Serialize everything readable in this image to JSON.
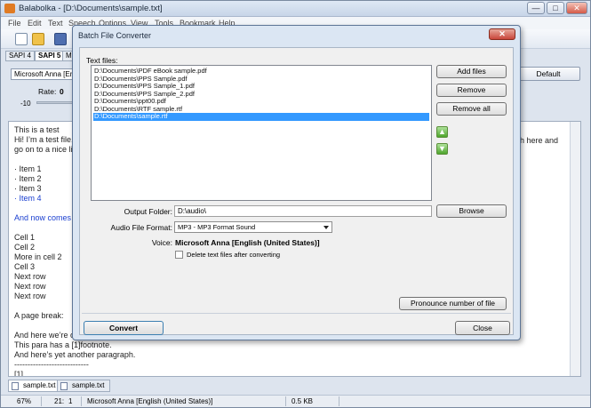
{
  "window": {
    "title": "Balabolka - [D:\\Documents\\sample.txt]",
    "controls": {
      "minimize": "—",
      "maximize": "□",
      "close": "✕"
    }
  },
  "menu": [
    "File",
    "Edit",
    "Text",
    "Speech",
    "Options",
    "View",
    "Tools",
    "Bookmark",
    "Help"
  ],
  "toolbar": {
    "icons": [
      "new-document-icon",
      "open-folder-icon",
      "save-icon"
    ]
  },
  "api_tabs": [
    "SAPI 4",
    "SAPI 5",
    "Mic"
  ],
  "voice_panel": {
    "voice_select": "Microsoft Anna [English",
    "default_button": "Default",
    "rate_label": "Rate:",
    "rate_value": "0",
    "rate_min": "-10"
  },
  "editor": {
    "lines": [
      {
        "text": "This is a test",
        "style": "normal"
      },
      {
        "text": "Hi! I’m a test file. T",
        "style": "normal"
      },
      {
        "text": "go on to a nice littl",
        "style": "normal"
      },
      {
        "text": "",
        "style": "normal"
      },
      {
        "text": "·  Item 1",
        "style": "normal"
      },
      {
        "text": "·  Item 2",
        "style": "normal"
      },
      {
        "text": "·  Item 3",
        "style": "normal"
      },
      {
        "text": "·  Item 4",
        "style": "blue"
      },
      {
        "text": "",
        "style": "normal"
      },
      {
        "text": "And now comes a",
        "style": "blue"
      },
      {
        "text": "",
        "style": "normal"
      },
      {
        "text": "Cell 1",
        "style": "normal"
      },
      {
        "text": "Cell 2",
        "style": "normal"
      },
      {
        "text": "More in cell 2",
        "style": "normal"
      },
      {
        "text": "Cell 3",
        "style": "normal"
      },
      {
        "text": "Next row",
        "style": "normal"
      },
      {
        "text": "Next row",
        "style": "normal"
      },
      {
        "text": "Next row",
        "style": "normal"
      },
      {
        "text": "",
        "style": "normal"
      },
      {
        "text": "A page break:",
        "style": "normal"
      },
      {
        "text": "",
        "style": "normal"
      },
      {
        "text": "And here we’re o",
        "style": "normal"
      },
      {
        "text": "This para has a [1]footnote.",
        "style": "normal"
      },
      {
        "text": "And here’s yet another paragraph.",
        "style": "normal"
      },
      {
        "text": "----------------------------",
        "style": "normal"
      },
      {
        "text": "[1]",
        "style": "normal"
      }
    ],
    "right_fragment": "aph here and"
  },
  "doc_tabs": [
    "sample.txt",
    "sample.txt"
  ],
  "status": {
    "zoom": "67%",
    "position": "21:",
    "column": "1",
    "voice": "Microsoft Anna [English (United States)]",
    "size": "0.5 KB"
  },
  "dialog": {
    "title": "Batch File Converter",
    "close_label": "✕",
    "files_label": "Text files:",
    "files": [
      "D:\\Documents\\PDF eBook sample.pdf",
      "D:\\Documents\\PPS Sample.pdf",
      "D:\\Documents\\PPS Sample_1.pdf",
      "D:\\Documents\\PPS Sample_2.pdf",
      "D:\\Documents\\ppt00.pdf",
      "D:\\Documents\\RTF sample.rtf",
      "D:\\Documents\\sample.rtf"
    ],
    "selected_index": 6,
    "buttons": {
      "add_files": "Add files",
      "remove": "Remove",
      "remove_all": "Remove all",
      "browse": "Browse",
      "pronounce": "Pronounce number of file",
      "convert": "Convert",
      "close": "Close"
    },
    "output_label": "Output Folder:",
    "output_value": "D:\\audio\\",
    "format_label": "Audio File Format:",
    "format_value": "MP3 - MP3 Format Sound",
    "voice_label": "Voice:",
    "voice_value": "Microsoft Anna [English (United States)]",
    "delete_label": "Delete text files after converting",
    "delete_checked": false,
    "colors": {
      "selection": "#3399ff",
      "arrow": "#4ea52c"
    }
  }
}
